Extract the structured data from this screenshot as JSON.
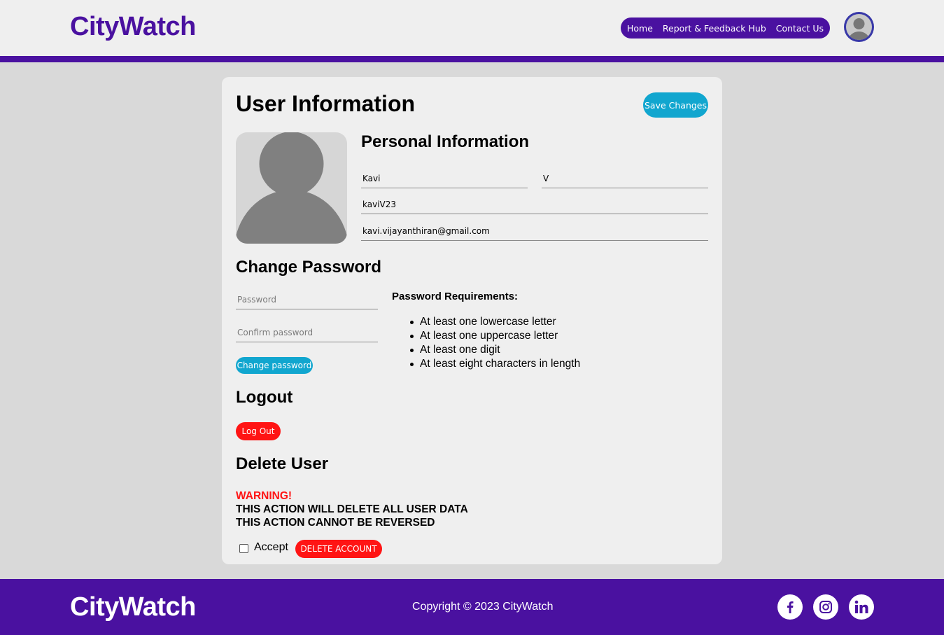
{
  "header": {
    "brand": "CityWatch",
    "nav": [
      "Home",
      "Report & Feedback Hub",
      "Contact Us"
    ]
  },
  "profile": {
    "title": "User Information",
    "save_label": "Save Changes",
    "personal_heading": "Personal Information",
    "first_name": "Kavi",
    "last_name": "V",
    "username": "kaviV23",
    "email": "kavi.vijayanthiran@gmail.com"
  },
  "password": {
    "heading": "Change Password",
    "password_placeholder": "Password",
    "confirm_placeholder": "Confirm password",
    "button_label": "Change password",
    "requirements_title": "Password Requirements:",
    "requirements": [
      "At least one lowercase letter",
      "At least one uppercase letter",
      "At least one digit",
      "At least eight characters in length"
    ]
  },
  "logout": {
    "heading": "Logout",
    "button_label": "Log Out"
  },
  "delete": {
    "heading": "Delete User",
    "warning": "WARNING!",
    "line1": "THIS ACTION WILL DELETE ALL USER DATA",
    "line2": "THIS ACTION CANNOT BE REVERSED",
    "accept_label": "Accept",
    "button_label": "DELETE ACCOUNT",
    "accepted": false
  },
  "footer": {
    "brand": "CityWatch",
    "copyright": "Copyright © 2023 CityWatch",
    "social_icons": [
      "facebook-icon",
      "instagram-icon",
      "linkedin-icon"
    ]
  },
  "colors": {
    "brand_purple": "#4a11a0",
    "accent_cyan": "#11a6cf",
    "danger_red": "#ff1414",
    "card_bg": "#efefef",
    "page_bg": "#d9d9d9"
  }
}
